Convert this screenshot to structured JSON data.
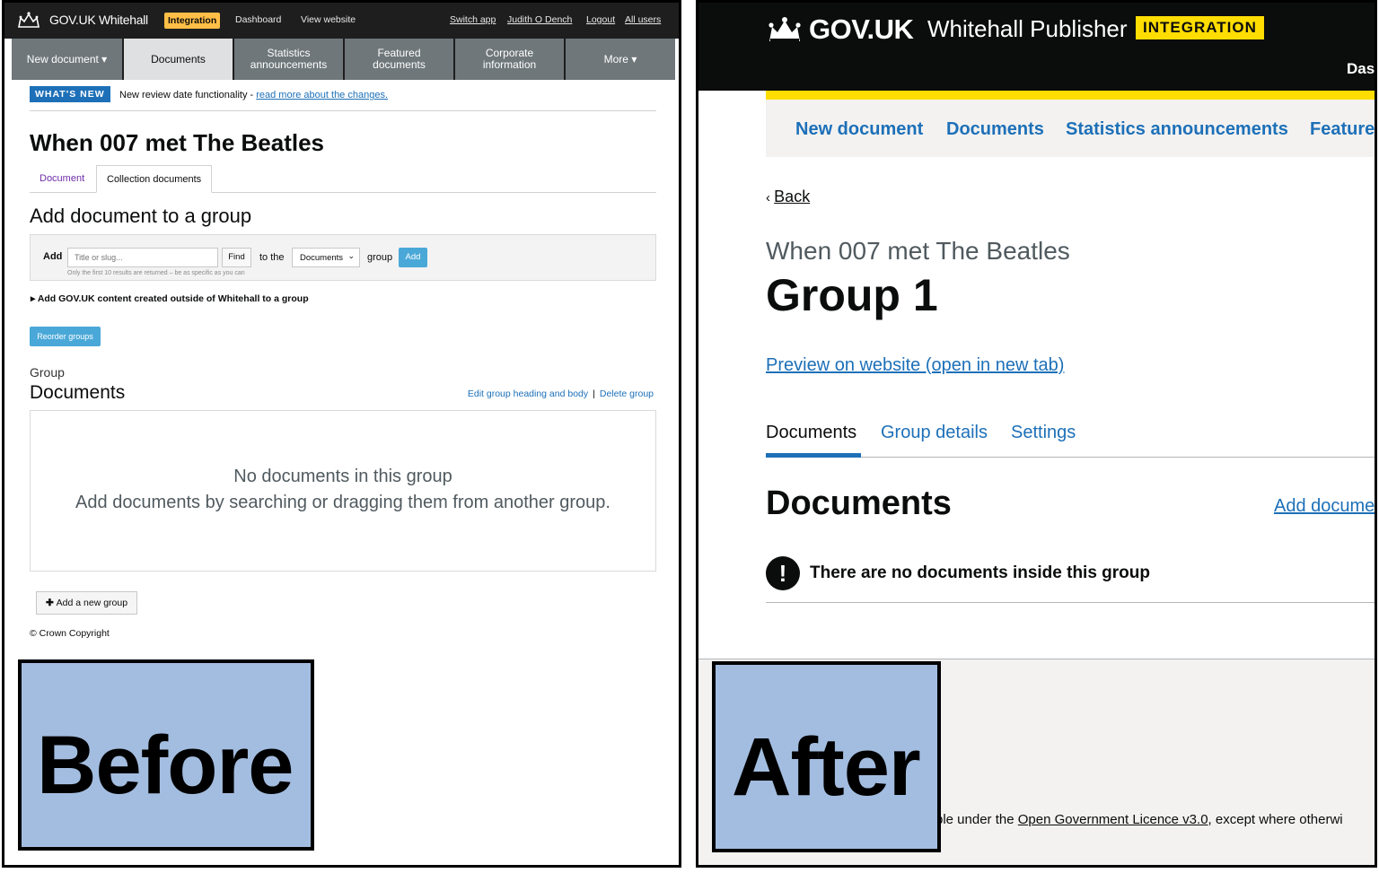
{
  "before": {
    "brand": "GOV.UK Whitehall",
    "environment_badge": "Integration",
    "top_links": [
      "Dashboard",
      "View website"
    ],
    "user_links": [
      "Switch app",
      "Judith O Dench",
      "Logout",
      "All users"
    ],
    "nav": [
      {
        "label": "New document ▾"
      },
      {
        "label": "Documents"
      },
      {
        "label": "Statistics\nannouncements"
      },
      {
        "label": "Featured\ndocuments"
      },
      {
        "label": "Corporate\ninformation"
      },
      {
        "label": "More ▾"
      }
    ],
    "whats_new": {
      "badge": "WHAT'S NEW",
      "text": "New review date functionality - ",
      "link": "read more about the changes."
    },
    "title": "When 007 met The Beatles",
    "tabs": [
      "Document",
      "Collection documents"
    ],
    "add_section": {
      "heading": "Add document to a group",
      "add_label": "Add",
      "placeholder": "Title or slug...",
      "find_button": "Find",
      "to_the": "to the",
      "selected_group": "Documents",
      "group_label": "group",
      "add_button": "Add",
      "hint": "Only the first 10 results are returned – be as specific as you can"
    },
    "outside_link": "Add GOV.UK content created outside of Whitehall to a group",
    "reorder_button": "Reorder groups",
    "group": {
      "caption": "Group",
      "name": "Documents",
      "edit_link": "Edit group heading and body",
      "delete_link": "Delete group",
      "empty_line1": "No documents in this group",
      "empty_line2": "Add documents by searching or dragging them from another group."
    },
    "add_group_button": "Add a new group",
    "copyright": "© Crown Copyright",
    "label": "Before"
  },
  "after": {
    "brand": "GOV.UK",
    "product": "Whitehall Publisher",
    "environment_badge": "INTEGRATION",
    "header_cut": "Das",
    "nav": [
      "New document",
      "Documents",
      "Statistics announcements",
      "Feature"
    ],
    "back": "Back",
    "caption": "When 007 met The Beatles",
    "title": "Group 1",
    "preview_link": "Preview on website (open in new tab)",
    "tabs": [
      "Documents",
      "Group details",
      "Settings"
    ],
    "section_heading": "Documents",
    "add_link": "Add docume",
    "warning": "There are no documents inside this group",
    "licence_prefix": "ble under the ",
    "licence_link": "Open Government Licence v3.0",
    "licence_suffix": ", except where otherwi",
    "label": "After"
  },
  "colors": {
    "link": "#1d70b8",
    "gov_yellow": "#ffdd00",
    "label_bg": "#a3bde0"
  }
}
